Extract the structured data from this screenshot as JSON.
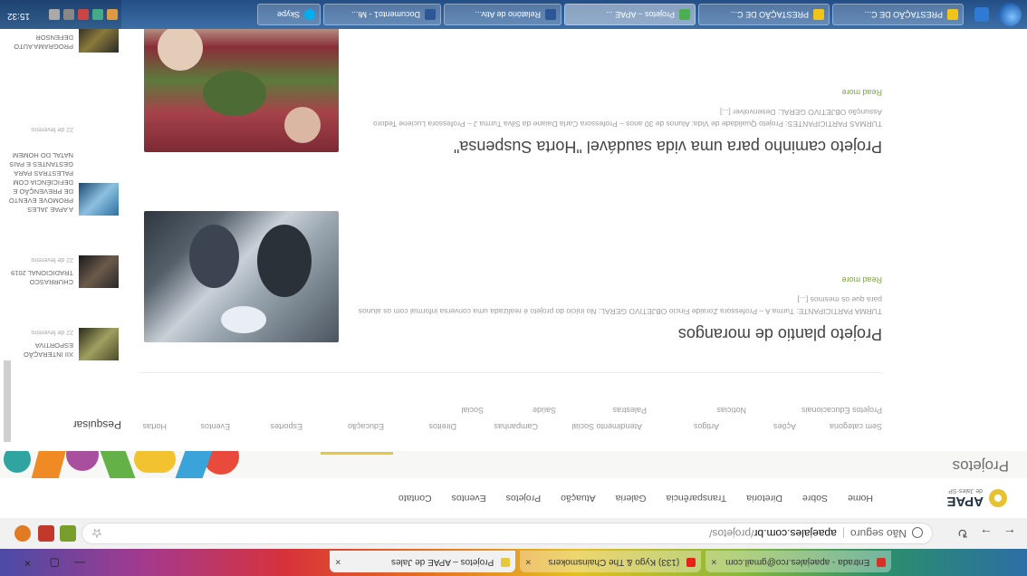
{
  "browser": {
    "tabs": [
      {
        "label": "Entrada - apaejales.rco@gmail.com",
        "active": false
      },
      {
        "label": "(133) Kygo & The Chainsmokers",
        "active": false
      },
      {
        "label": "Projetos – APAE de Jales",
        "active": true
      }
    ],
    "new_tab": "+",
    "window_controls": {
      "minimize": "—",
      "maximize": "▢",
      "close": "×"
    },
    "address": {
      "security_label": "Não seguro",
      "host": "apaejales.com.br",
      "path": "/projetos/"
    }
  },
  "site": {
    "logo_name": "APAE",
    "logo_sub": "de Jales-SP",
    "nav": [
      "Home",
      "Sobre",
      "Diretoria",
      "Transparência",
      "Galeria",
      "Atuação",
      "Projetos",
      "Eventos",
      "Contato"
    ],
    "page_title": "Projetos",
    "search_label": "Pesquisar",
    "categories_row1": [
      "Sem categoria",
      "Ações",
      "Artigos",
      "Atendimento Social",
      "Campanhas",
      "Direitos",
      "Educação",
      "Esportes",
      "Eventos",
      "Hortas"
    ],
    "categories_row2": [
      "Projetos Educacionais",
      "Notícias",
      "Palestras",
      "Saúde",
      "Social"
    ],
    "posts": [
      {
        "title": "Projeto plantio de morangos",
        "description": "TURMA PARTICIPANTE: Turma A – Professora Zoraide Fincio OBJETIVO GERAL: No início do projeto é realizada uma conversa informal com os alunos para que os mesmos [...]",
        "read_more": "Read more"
      },
      {
        "title": "Projeto caminho para uma vida saudável \"Horta Suspensa\"",
        "description": "TURMAS PARTICIPANTES: Projeto Qualidade de Vida: Alunos de 30 anos – Professora Carla Daiane da Silva Turma J – Professora Luciene Tedoro Assunção OBJETIVO GERAL: Desenvolver [...]",
        "read_more": "Read more"
      }
    ],
    "sidebar": [
      {
        "title": "XII INTERAÇÃO ESPORTIVA",
        "date": "22 de fevereiro"
      },
      {
        "title": "CHURRASCO TRADICIONAL 2019",
        "date": "22 de fevereiro"
      },
      {
        "title": "A APAE JALES PROMOVE EVENTO DE PREVENÇÃO E DEFICIÊNCIA COM PALESTRAS PARA GESTANTES E PAIS NATAL DO HOMEM",
        "date": "22 de fevereiro"
      },
      {
        "title": "PROGRAMA AUTO DEFENSOR",
        "date": ""
      }
    ]
  },
  "taskbar": {
    "items": [
      {
        "label": "PRESTAÇÃO DE C...",
        "active": false
      },
      {
        "label": "PRESTAÇÃO DE C...",
        "active": false
      },
      {
        "label": "Projetos – APAE ...",
        "active": true
      },
      {
        "label": "Relatório de Ativ...",
        "active": false
      },
      {
        "label": "Documento1 - Mi...",
        "active": false
      },
      {
        "label": "Skype",
        "active": false
      }
    ],
    "clock": "15:32"
  }
}
